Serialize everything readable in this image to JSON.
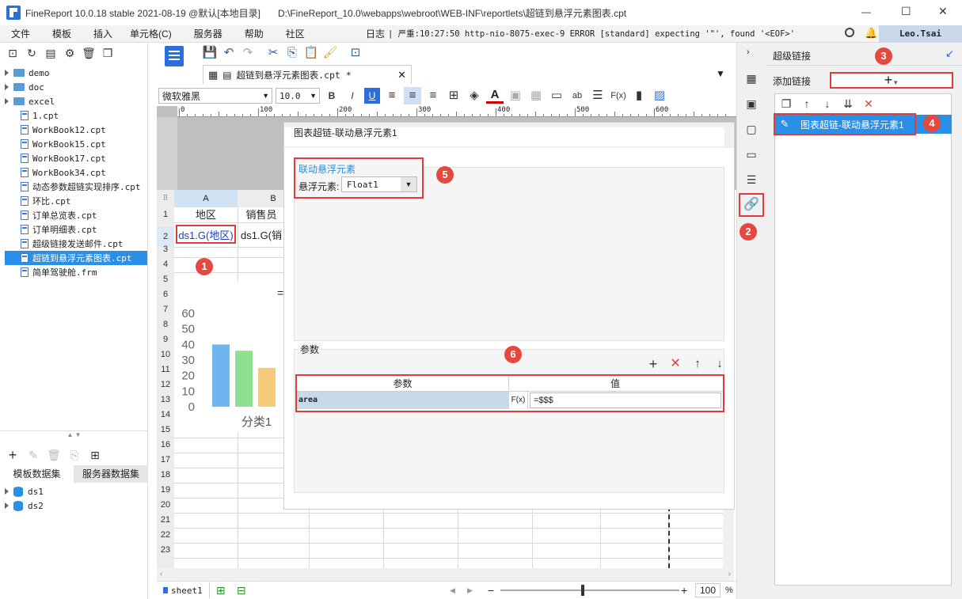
{
  "window": {
    "title": "FineReport 10.0.18 stable 2021-08-19 @默认[本地目录]",
    "path": "D:\\FineReport_10.0\\webapps\\webroot\\WEB-INF\\reportlets\\超链到悬浮元素图表.cpt",
    "minimize": "—",
    "maximize": "☐",
    "close": "✕"
  },
  "menu": [
    "文件",
    "模板",
    "插入",
    "单元格(C)",
    "服务器",
    "帮助",
    "社区"
  ],
  "log": {
    "prefix": "日志",
    "text": "| 严重:10:27:50 http-nio-8075-exec-9 ERROR [standard] expecting '\"', found '<EOF>'"
  },
  "user": "Leo.Tsai",
  "tree": {
    "folders": [
      "demo",
      "doc",
      "excel"
    ],
    "files": [
      "1.cpt",
      "WorkBook12.cpt",
      "WorkBook15.cpt",
      "WorkBook17.cpt",
      "WorkBook34.cpt",
      "动态参数超链实现排序.cpt",
      "环比.cpt",
      "订单总览表.cpt",
      "订单明细表.cpt",
      "超级链接发送邮件.cpt",
      "超链到悬浮元素图表.cpt",
      "简单驾驶舱.frm"
    ],
    "selected_index": 10
  },
  "dataset": {
    "tab_template": "模板数据集",
    "tab_server": "服务器数据集",
    "items": [
      "ds1",
      "ds2"
    ]
  },
  "editor": {
    "tab_label": "超链到悬浮元素图表.cpt *",
    "font_name": "微软雅黑",
    "font_size": "10.0",
    "ruler_ticks": [
      "0",
      "100",
      "200",
      "300",
      "400",
      "500",
      "600"
    ],
    "columns": [
      "A",
      "B"
    ],
    "rows": [
      "1",
      "2",
      "3",
      "4",
      "5",
      "6",
      "7",
      "8",
      "9",
      "10",
      "11",
      "12",
      "13",
      "14",
      "15",
      "16",
      "17",
      "18",
      "19",
      "20",
      "21",
      "22",
      "23"
    ],
    "cell_a1": "地区",
    "cell_b1": "销售员",
    "cell_a2": "ds1.G(地区)",
    "cell_b2": "ds1.G(销",
    "sheet_tab": "sheet1",
    "zoom": "100",
    "zoom_unit": "%"
  },
  "chart_data": {
    "type": "bar",
    "categories": [
      "分类1"
    ],
    "ylim": [
      0,
      60
    ],
    "yticks": [
      "60",
      "50",
      "40",
      "30",
      "20",
      "10",
      "0"
    ],
    "series": [
      {
        "values": [
          40
        ],
        "color": "#6fb6f0"
      },
      {
        "values": [
          36
        ],
        "color": "#8ee08e"
      },
      {
        "values": [
          25
        ],
        "color": "#f7c97a"
      }
    ],
    "title_fragment": "="
  },
  "dialog": {
    "title": "图表超链-联动悬浮元素1",
    "group_label": "联动悬浮元素",
    "float_label": "悬浮元素:",
    "float_value": "Float1",
    "params_label": "参数",
    "col_param": "参数",
    "col_value": "值",
    "param_name": "area",
    "param_fx": "F(x)",
    "param_value": "=$$$"
  },
  "right_panel": {
    "title": "超级链接",
    "add_label": "添加链接",
    "link_item": "图表超链-联动悬浮元素1"
  },
  "badges": [
    "1",
    "2",
    "3",
    "4",
    "5",
    "6"
  ]
}
